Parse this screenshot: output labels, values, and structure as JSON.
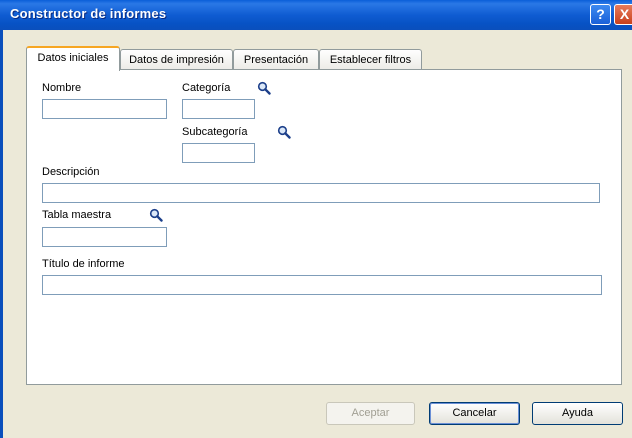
{
  "window": {
    "title": "Constructor de informes",
    "help_glyph": "?",
    "close_glyph": "X"
  },
  "tabs": [
    {
      "label": "Datos iniciales",
      "active": true
    },
    {
      "label": "Datos de impresión",
      "active": false
    },
    {
      "label": "Presentación",
      "active": false
    },
    {
      "label": "Establecer filtros",
      "active": false
    }
  ],
  "form": {
    "nombre": {
      "label": "Nombre",
      "value": ""
    },
    "categoria": {
      "label": "Categoría",
      "value": "",
      "icon": "magnifier-icon"
    },
    "subcategoria": {
      "label": "Subcategoría",
      "value": "",
      "icon": "magnifier-icon"
    },
    "descripcion": {
      "label": "Descripción",
      "value": ""
    },
    "tabla_maestra": {
      "label": "Tabla maestra",
      "value": "",
      "icon": "magnifier-icon"
    },
    "titulo_informe": {
      "label": "Título de informe",
      "value": ""
    }
  },
  "buttons": {
    "aceptar": {
      "label": "Aceptar",
      "enabled": false
    },
    "cancelar": {
      "label": "Cancelar",
      "enabled": true
    },
    "ayuda": {
      "label": "Ayuda",
      "enabled": true
    }
  },
  "colors": {
    "titlebar": "#0a5fd8",
    "tab_highlight": "#f6a623",
    "field_border": "#7f9db9"
  }
}
